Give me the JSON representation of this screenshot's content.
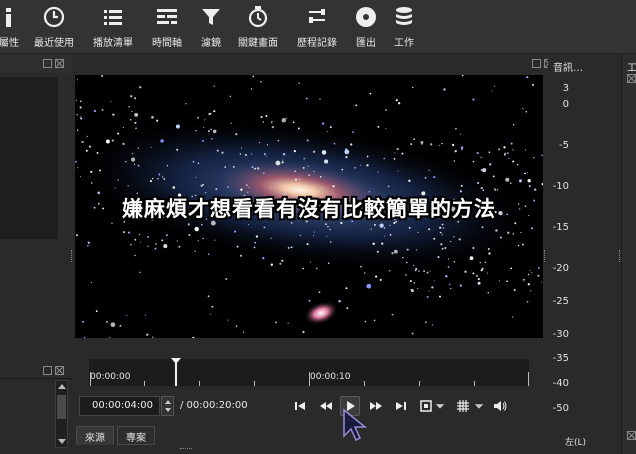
{
  "toolbar": {
    "items": [
      {
        "label": "屬性",
        "icon": "info-icon"
      },
      {
        "label": "最近使用",
        "icon": "clock-icon"
      },
      {
        "label": "播放清單",
        "icon": "list-icon"
      },
      {
        "label": "時間軸",
        "icon": "timeline-icon"
      },
      {
        "label": "濾鏡",
        "icon": "filter-icon"
      },
      {
        "label": "關鍵畫面",
        "icon": "stopwatch-icon"
      },
      {
        "label": "歷程記錄",
        "icon": "history-icon"
      },
      {
        "label": "匯出",
        "icon": "disc-icon"
      },
      {
        "label": "工作",
        "icon": "stack-icon"
      }
    ]
  },
  "viewer": {
    "caption": "嫌麻煩才想看看有沒有比較簡單的方法"
  },
  "audio_meter": {
    "title": "音訊…",
    "scale": [
      "3",
      "0",
      "-5",
      "-10",
      "-15",
      "-20",
      "-25",
      "-30",
      "-35",
      "-40",
      "-50"
    ],
    "channel_label": "左(L)"
  },
  "right_panel": {
    "title": "工"
  },
  "timeline": {
    "tick_labels": [
      "00:00:00",
      "00:00:10"
    ]
  },
  "transport": {
    "position": "00:00:04:00",
    "duration": "/ 00:00:20:00"
  },
  "tabs": {
    "source": "來源",
    "project": "專案"
  },
  "colors": {
    "background": "#2a2a2a",
    "toolbar": "#333333",
    "viewer": "#000000"
  }
}
